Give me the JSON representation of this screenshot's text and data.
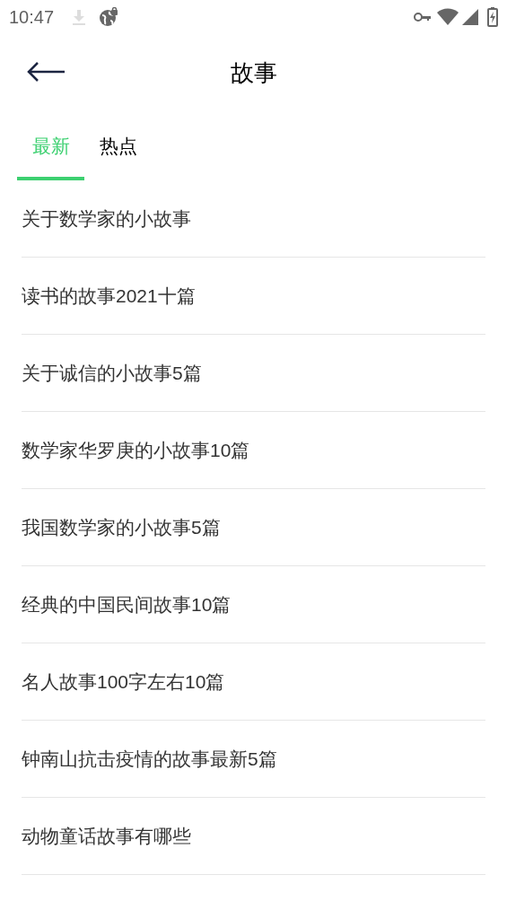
{
  "status_bar": {
    "time": "10:47"
  },
  "header": {
    "title": "故事"
  },
  "tabs": [
    {
      "label": "最新",
      "selected": true
    },
    {
      "label": "热点",
      "selected": false
    }
  ],
  "items": [
    "关于数学家的小故事",
    "读书的故事2021十篇",
    "关于诚信的小故事5篇",
    "数学家华罗庚的小故事10篇",
    "我国数学家的小故事5篇",
    "经典的中国民间故事10篇",
    "名人故事100字左右10篇",
    "钟南山抗击疫情的故事最新5篇",
    "动物童话故事有哪些"
  ]
}
